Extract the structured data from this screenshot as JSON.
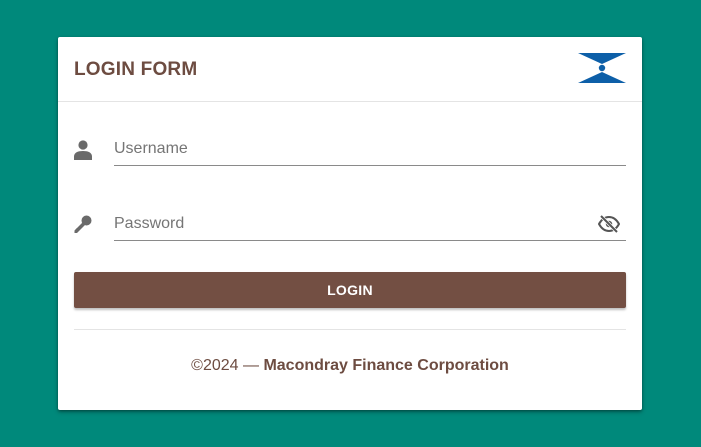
{
  "header": {
    "title": "LOGIN FORM",
    "logo_icon": "macondray-logo-icon",
    "logo_color": "#0d5fa8"
  },
  "form": {
    "username": {
      "icon": "person-icon",
      "placeholder": "Username",
      "value": ""
    },
    "password": {
      "icon": "key-icon",
      "placeholder": "Password",
      "value": "",
      "toggle_icon": "eye-off-icon"
    },
    "login_label": "LOGIN"
  },
  "footer": {
    "copyright": "©2024 —",
    "company": "Macondray Finance Corporation"
  },
  "colors": {
    "background": "#00897b",
    "accent": "#6d4c41",
    "button": "#734f43"
  }
}
